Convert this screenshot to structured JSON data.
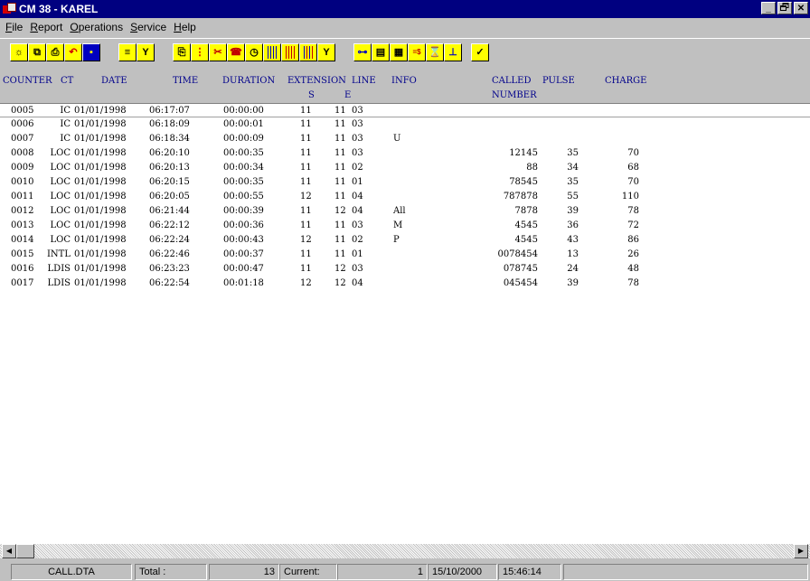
{
  "window": {
    "title": "CM 38 - KAREL",
    "minimize": "_",
    "restore": "̅̅",
    "close": "✕"
  },
  "menu": [
    {
      "label": "File",
      "ul": "F",
      "rest": "ile"
    },
    {
      "label": "Report",
      "ul": "R",
      "rest": "eport"
    },
    {
      "label": "Operations",
      "ul": "O",
      "rest": "perations"
    },
    {
      "label": "Service",
      "ul": "S",
      "rest": "ervice"
    },
    {
      "label": "Help",
      "ul": "H",
      "rest": "elp"
    }
  ],
  "toolbar_icons": [
    "new-report-icon",
    "copy-icon",
    "print-icon",
    "undo-icon",
    "exit-door-icon",
    "list-icon",
    "filter-icon",
    "file-copy-icon",
    "columns-icon",
    "tools-icon",
    "phone-icon",
    "timer-icon",
    "bar-chart-blue-icon",
    "bar-chart-red-icon",
    "bar-chart-mixed-icon",
    "edit-filter-icon",
    "connect-icon",
    "document-icon",
    "calculator-icon",
    "exchange-rate-icon",
    "hourglass-icon",
    "network-icon",
    "help-check-icon"
  ],
  "headers": {
    "counter": "COUNTER",
    "ct": "CT",
    "date": "DATE",
    "time": "TIME",
    "duration": "DURATION",
    "extension": "EXTENSION",
    "line": "LINE",
    "info": "INFO",
    "called": "CALLED",
    "pulse": "PULSE",
    "charge": "CHARGE",
    "sub_s": "S",
    "sub_e": "E",
    "sub_number": "NUMBER"
  },
  "rows": [
    {
      "counter": "0005",
      "ct": "IC",
      "date": "01/01/1998",
      "time": "06:17:07",
      "duration": "00:00:00",
      "ext": "11",
      "line_a": "11",
      "line_b": "03",
      "info": "",
      "called": "",
      "pulse": "",
      "charge": ""
    },
    {
      "counter": "0006",
      "ct": "IC",
      "date": "01/01/1998",
      "time": "06:18:09",
      "duration": "00:00:01",
      "ext": "11",
      "line_a": "11",
      "line_b": "03",
      "info": "",
      "called": "",
      "pulse": "",
      "charge": ""
    },
    {
      "counter": "0007",
      "ct": "IC",
      "date": "01/01/1998",
      "time": "06:18:34",
      "duration": "00:00:09",
      "ext": "11",
      "line_a": "11",
      "line_b": "03",
      "info": "U",
      "called": "",
      "pulse": "",
      "charge": ""
    },
    {
      "counter": "0008",
      "ct": "LOC",
      "date": "01/01/1998",
      "time": "06:20:10",
      "duration": "00:00:35",
      "ext": "11",
      "line_a": "11",
      "line_b": "03",
      "info": "",
      "called": "12145",
      "pulse": "35",
      "charge": "70"
    },
    {
      "counter": "0009",
      "ct": "LOC",
      "date": "01/01/1998",
      "time": "06:20:13",
      "duration": "00:00:34",
      "ext": "11",
      "line_a": "11",
      "line_b": "02",
      "info": "",
      "called": "88",
      "pulse": "34",
      "charge": "68"
    },
    {
      "counter": "0010",
      "ct": "LOC",
      "date": "01/01/1998",
      "time": "06:20:15",
      "duration": "00:00:35",
      "ext": "11",
      "line_a": "11",
      "line_b": "01",
      "info": "",
      "called": "78545",
      "pulse": "35",
      "charge": "70"
    },
    {
      "counter": "0011",
      "ct": "LOC",
      "date": "01/01/1998",
      "time": "06:20:05",
      "duration": "00:00:55",
      "ext": "12",
      "line_a": "11",
      "line_b": "04",
      "info": "",
      "called": "787878",
      "pulse": "55",
      "charge": "110"
    },
    {
      "counter": "0012",
      "ct": "LOC",
      "date": "01/01/1998",
      "time": "06:21:44",
      "duration": "00:00:39",
      "ext": "11",
      "line_a": "12",
      "line_b": "04",
      "info": "All",
      "called": "7878",
      "pulse": "39",
      "charge": "78"
    },
    {
      "counter": "0013",
      "ct": "LOC",
      "date": "01/01/1998",
      "time": "06:22:12",
      "duration": "00:00:36",
      "ext": "11",
      "line_a": "11",
      "line_b": "03",
      "info": "M",
      "called": "4545",
      "pulse": "36",
      "charge": "72"
    },
    {
      "counter": "0014",
      "ct": "LOC",
      "date": "01/01/1998",
      "time": "06:22:24",
      "duration": "00:00:43",
      "ext": "12",
      "line_a": "11",
      "line_b": "02",
      "info": "P",
      "called": "4545",
      "pulse": "43",
      "charge": "86"
    },
    {
      "counter": "0015",
      "ct": "INTL",
      "date": "01/01/1998",
      "time": "06:22:46",
      "duration": "00:00:37",
      "ext": "11",
      "line_a": "11",
      "line_b": "01",
      "info": "",
      "called": "0078454",
      "pulse": "13",
      "charge": "26"
    },
    {
      "counter": "0016",
      "ct": "LDIS",
      "date": "01/01/1998",
      "time": "06:23:23",
      "duration": "00:00:47",
      "ext": "11",
      "line_a": "12",
      "line_b": "03",
      "info": "",
      "called": "078745",
      "pulse": "24",
      "charge": "48"
    },
    {
      "counter": "0017",
      "ct": "LDIS",
      "date": "01/01/1998",
      "time": "06:22:54",
      "duration": "00:01:18",
      "ext": "12",
      "line_a": "12",
      "line_b": "04",
      "info": "",
      "called": "045454",
      "pulse": "39",
      "charge": "78"
    }
  ],
  "status": {
    "file": "CALL.DTA",
    "total_label": "Total :",
    "total_value": "13",
    "current_label": "Current:",
    "current_value": "1",
    "date": "15/10/2000",
    "time": "15:46:14"
  },
  "colors": {
    "title_bg": "#000080",
    "header_text": "#00008b",
    "toolbar_btn": "#ffff00"
  }
}
